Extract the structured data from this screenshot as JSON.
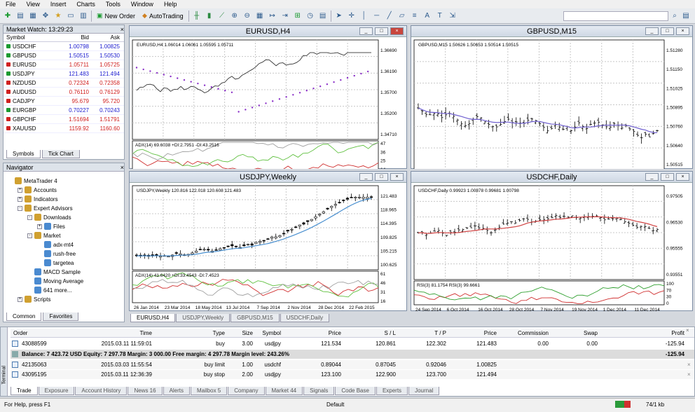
{
  "menu": [
    "File",
    "View",
    "Insert",
    "Charts",
    "Tools",
    "Window",
    "Help"
  ],
  "toolbar": {
    "new_order": "New Order",
    "autotrading": "AutoTrading"
  },
  "market_watch": {
    "title": "Market Watch: 13:29:23",
    "cols": [
      "Symbol",
      "Bid",
      "Ask"
    ],
    "rows": [
      {
        "sym": "USDCHF",
        "bid": "1.00798",
        "ask": "1.00825",
        "dir": "up"
      },
      {
        "sym": "GBPUSD",
        "bid": "1.50515",
        "ask": "1.50530",
        "dir": "up"
      },
      {
        "sym": "EURUSD",
        "bid": "1.05711",
        "ask": "1.05725",
        "dir": "down"
      },
      {
        "sym": "USDJPY",
        "bid": "121.483",
        "ask": "121.494",
        "dir": "up"
      },
      {
        "sym": "NZDUSD",
        "bid": "0.72324",
        "ask": "0.72358",
        "dir": "down"
      },
      {
        "sym": "AUDUSD",
        "bid": "0.76110",
        "ask": "0.76129",
        "dir": "down"
      },
      {
        "sym": "CADJPY",
        "bid": "95.679",
        "ask": "95.720",
        "dir": "down"
      },
      {
        "sym": "EURGBP",
        "bid": "0.70227",
        "ask": "0.70243",
        "dir": "up"
      },
      {
        "sym": "GBPCHF",
        "bid": "1.51694",
        "ask": "1.51791",
        "dir": "down"
      },
      {
        "sym": "XAUUSD",
        "bid": "1159.92",
        "ask": "1160.60",
        "dir": "down"
      }
    ],
    "tabs": [
      "Symbols",
      "Tick Chart"
    ]
  },
  "navigator": {
    "title": "Navigator",
    "items": [
      "MetaTrader 4",
      "Accounts",
      "Indicators",
      "Expert Advisors",
      "Downloads",
      "Files",
      "Market",
      "adx-mt4",
      "rush-free",
      "targetea",
      "MACD Sample",
      "Moving Average",
      "641 more...",
      "Scripts"
    ],
    "tabs": [
      "Common",
      "Favorites"
    ]
  },
  "charts": [
    {
      "title": "EURUSD,H4",
      "info": "EURUSD,H4  1.06014 1.06061 1.05595 1.05711",
      "ind": "ADX(14) 69.6038 +DI:2.7951 -DI:43.2516",
      "prices": [
        "1.36690",
        "1.36190",
        "1.35700",
        "1.35200",
        "1.34710"
      ],
      "ind_ticks": [
        "47",
        "36",
        "25",
        "14"
      ],
      "dates": [
        "4 Oct 2013",
        "8 Oct 00:00",
        "9 Oct 08:00",
        "10 Oct 16:00",
        "14 Oct 00:00",
        "15 Oct 08:00",
        "16 Oct 16:00",
        "18 Oct 00:00"
      ]
    },
    {
      "title": "GBPUSD,M15",
      "info": "GBPUSD,M15  1.50626 1.50653 1.50514 1.50515",
      "prices": [
        "1.51280",
        "1.51150",
        "1.51025",
        "1.50895",
        "1.50760",
        "1.50640",
        "1.50515"
      ],
      "dates": [
        "6 Mar 2015",
        "9 Mar 07:15",
        "9 Mar 09:15",
        "9 Mar 11:15",
        "9 Mar 13:15",
        "9 Mar 15:15",
        "9 Mar 17:15",
        "9 Mar 19:15"
      ]
    },
    {
      "title": "USDJPY,Weekly",
      "info": "USDJPY,Weekly  120.816 122.018 120.608 121.483",
      "ind": "ADX(14) 41.6420 +DI:33.4543 -DI:7.4523",
      "prices": [
        "121.483",
        "118.965",
        "114.395",
        "109.825",
        "105.215",
        "100.625"
      ],
      "ind_ticks": [
        "61",
        "46",
        "31",
        "16"
      ],
      "dates": [
        "26 Jan 2014",
        "23 Mar 2014",
        "18 May 2014",
        "13 Jul 2014",
        "7 Sep 2014",
        "2 Nov 2014",
        "28 Dec 2014",
        "22 Feb 2015"
      ]
    },
    {
      "title": "USDCHF,Daily",
      "info": "USDCHF,Daily  0.99923 1.00878 0.99681 1.00798",
      "ind": "RSI(3) 81.1754 RSI(3) 99.6661",
      "prices": [
        "0.97505",
        "0.96530",
        "0.95555",
        "0.93551"
      ],
      "ind_ticks": [
        "100",
        "70",
        "30",
        "0"
      ],
      "dates": [
        "24 Sep 2014",
        "6 Oct 2014",
        "16 Oct 2014",
        "28 Oct 2014",
        "7 Nov 2014",
        "19 Nov 2014",
        "1 Dec 2014",
        "11 Dec 2014"
      ]
    }
  ],
  "chart_tabs": [
    "EURUSD,H4",
    "USDJPY,Weekly",
    "GBPUSD,M15",
    "USDCHF,Daily"
  ],
  "terminal": {
    "cols": [
      "Order",
      "Time",
      "Type",
      "Size",
      "Symbol",
      "Price",
      "S / L",
      "T / P",
      "Price",
      "Commission",
      "Swap",
      "Profit"
    ],
    "rows": [
      {
        "order": "43088599",
        "time": "2015.03.11 11:59:01",
        "type": "buy",
        "size": "3.00",
        "symbol": "usdjpy",
        "price": "121.534",
        "sl": "120.861",
        "tp": "122.302",
        "cur": "121.483",
        "comm": "0.00",
        "swap": "0.00",
        "profit": "-125.94"
      },
      {
        "order": "42135063",
        "time": "2015.03.03 11:55:54",
        "type": "buy limit",
        "size": "1.00",
        "symbol": "usdchf",
        "price": "0.89044",
        "sl": "0.87045",
        "tp": "0.92046",
        "cur": "1.00825",
        "comm": "",
        "swap": "",
        "profit": ""
      },
      {
        "order": "43095195",
        "time": "2015.03.11 12:36:39",
        "type": "buy stop",
        "size": "2.00",
        "symbol": "usdjpy",
        "price": "123.100",
        "sl": "122.900",
        "tp": "123.700",
        "cur": "121.494",
        "comm": "",
        "swap": "",
        "profit": ""
      }
    ],
    "balance": "Balance: 7 423.72 USD  Equity: 7 297.78  Margin: 3 000.00  Free margin: 4 297.78  Margin level: 243.26%",
    "balance_profit": "-125.94",
    "tabs": [
      "Trade",
      "Exposure",
      "Account History",
      "News 16",
      "Alerts",
      "Mailbox 5",
      "Company",
      "Market 44",
      "Signals",
      "Code Base",
      "Experts",
      "Journal"
    ],
    "side_label": "Terminal"
  },
  "status": {
    "help": "For Help, press F1",
    "profile": "Default",
    "traffic": "74/1 kb"
  }
}
